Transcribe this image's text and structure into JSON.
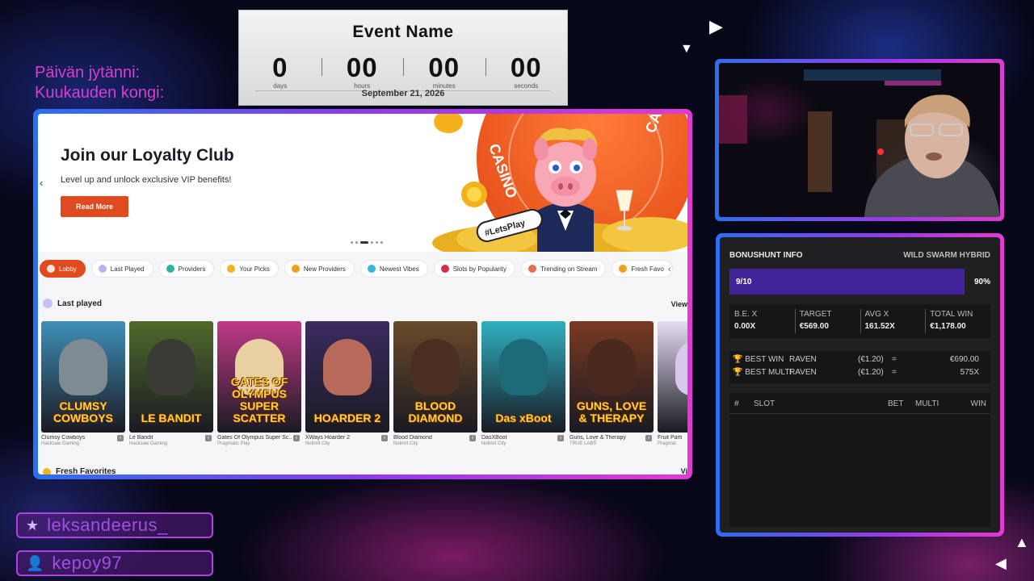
{
  "countdown": {
    "event_name": "Event Name",
    "units": [
      {
        "value": "0",
        "label": "days"
      },
      {
        "value": "00",
        "label": "hours"
      },
      {
        "value": "00",
        "label": "minutes"
      },
      {
        "value": "00",
        "label": "seconds"
      }
    ],
    "date": "September 21, 2026"
  },
  "side_titles": {
    "daily": "Päivän jytänni:",
    "monthly": "Kuukauden kongi:"
  },
  "site": {
    "hero": {
      "title": "Join our Loyalty Club",
      "subtitle": "Level up and unlock exclusive VIP benefits!",
      "button": "Read More",
      "badge": "#LetsPlay",
      "casino_text": "CASINO"
    },
    "categories": [
      {
        "label": "Lobby",
        "color": "#ffffff",
        "active": true
      },
      {
        "label": "Last Played",
        "color": "#b9b3f2"
      },
      {
        "label": "Providers",
        "color": "#2bb59a"
      },
      {
        "label": "Your Picks",
        "color": "#f0b322"
      },
      {
        "label": "New Providers",
        "color": "#f0a020"
      },
      {
        "label": "Newest Vibes",
        "color": "#38b8e0"
      },
      {
        "label": "Slots by Popularity",
        "color": "#d0304a"
      },
      {
        "label": "Trending on Stream",
        "color": "#e07050"
      },
      {
        "label": "Fresh Favo",
        "color": "#f0a020"
      }
    ],
    "last_played": {
      "title": "Last played",
      "view_all": "View",
      "games": [
        {
          "name": "Clumsy Cowboys",
          "provider": "Hacksaw Gaming",
          "art": "CLUMSY COWBOYS",
          "bg": "#3f8fb8",
          "fig": "#7f8a92"
        },
        {
          "name": "Le Bandit",
          "provider": "Hacksaw Gaming",
          "art": "LE BANDIT",
          "bg": "#4f6a2a",
          "fig": "#3b3b35"
        },
        {
          "name": "Gates Of Olympus Super Sc...",
          "provider": "Pragmatic Play",
          "art": "GATES OF OLYMPUS SUPER SCATTER",
          "bg": "#c13a86",
          "fig": "#e8d0a0"
        },
        {
          "name": "XWays Hoarder 2",
          "provider": "Nolimit City",
          "art": "HOARDER 2",
          "bg": "#3b2b60",
          "fig": "#b86a5a"
        },
        {
          "name": "Blood Diamond",
          "provider": "Nolimit City",
          "art": "BLOOD DIAMOND",
          "bg": "#6a4a2a",
          "fig": "#4a2f22"
        },
        {
          "name": "DasXBoot",
          "provider": "Nolimit City",
          "art": "Das xBoot",
          "bg": "#2fb0c0",
          "fig": "#1d6b78"
        },
        {
          "name": "Guns, Love & Therapy",
          "provider": "TRUE LABŠ",
          "art": "GUNS, LOVE & THERAPY",
          "bg": "#7a3a22",
          "fig": "#4a2a1e"
        },
        {
          "name": "Fruit Parti",
          "provider": "Pragmat",
          "art": "",
          "bg": "#e6dcf2",
          "fig": "#d9c8ee"
        }
      ]
    },
    "next_section": {
      "title": "Fresh Favorites",
      "view_all": "Vi"
    }
  },
  "bonushunt": {
    "title": "BONUSHUNT INFO",
    "current_slot": "WILD SWARM HYBRID",
    "progress_label": "9/10",
    "progress_percent": "90%",
    "progress_fraction": 0.9,
    "stats": [
      {
        "label": "B.E. X",
        "value": "0.00X"
      },
      {
        "label": "TARGET",
        "value": "€569.00"
      },
      {
        "label": "AVG X",
        "value": "161.52X"
      },
      {
        "label": "TOTAL WIN",
        "value": "€1,178.00"
      }
    ],
    "best_win": {
      "label": "BEST WIN",
      "player": "RAVEN",
      "bet": "(€1.20)",
      "eq": "=",
      "result": "€690.00"
    },
    "best_multi": {
      "label": "BEST MULTI",
      "player": "RAVEN",
      "bet": "(€1.20)",
      "eq": "=",
      "result": "575X"
    },
    "table_headers": {
      "num": "#",
      "slot": "SLOT",
      "bet": "BET",
      "multi": "MULTI",
      "win": "WIN"
    }
  },
  "social": {
    "twitch": "leksandeerus_",
    "viewer": "kepoy97"
  }
}
